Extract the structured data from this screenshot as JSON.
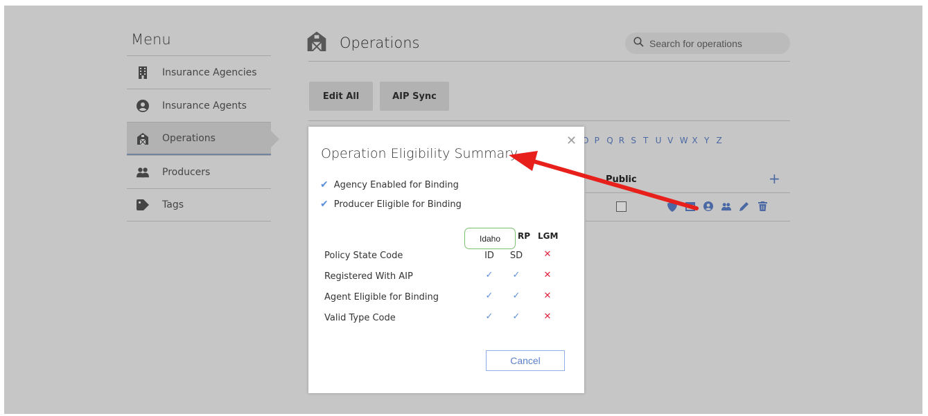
{
  "sidebar": {
    "title": "Menu",
    "items": [
      {
        "label": "Insurance Agencies",
        "icon": "building-icon"
      },
      {
        "label": "Insurance Agents",
        "icon": "user-circle-icon"
      },
      {
        "label": "Operations",
        "icon": "barn-icon",
        "active": true
      },
      {
        "label": "Producers",
        "icon": "users-icon"
      },
      {
        "label": "Tags",
        "icon": "tag-icon"
      }
    ]
  },
  "header": {
    "title": "Operations",
    "search_placeholder": "Search for operations"
  },
  "toolbar": {
    "edit_all_label": "Edit All",
    "aip_sync_label": "AIP Sync"
  },
  "alphabet_visible": [
    "O",
    "P",
    "Q",
    "R",
    "S",
    "T",
    "U",
    "V",
    "W",
    "X",
    "Y",
    "Z"
  ],
  "table": {
    "column_public": "Public",
    "add_label": "+",
    "row_actions": [
      "shield-icon",
      "calendar-icon",
      "user-circle-icon",
      "users-icon",
      "pencil-icon",
      "trash-icon"
    ]
  },
  "modal": {
    "title": "Operation Eligibility Summary",
    "close_label": "✕",
    "statuses": [
      {
        "label": "Agency Enabled for Binding",
        "ok": true
      },
      {
        "label": "Producer Eligible for Binding",
        "ok": true
      }
    ],
    "columns": [
      "",
      "RP",
      "LGM"
    ],
    "tooltip": "Idaho",
    "rows": [
      {
        "label": "Policy State Code",
        "cells": [
          "ID",
          "SD",
          "✕"
        ]
      },
      {
        "label": "Registered With AIP",
        "cells": [
          "✓",
          "✓",
          "✕"
        ]
      },
      {
        "label": "Agent Eligible for Binding",
        "cells": [
          "✓",
          "✓",
          "✕"
        ]
      },
      {
        "label": "Valid Type Code",
        "cells": [
          "✓",
          "✓",
          "✕"
        ]
      }
    ],
    "cancel_label": "Cancel"
  },
  "colors": {
    "accent_blue": "#5b7fc7",
    "check_blue": "#5b8fd9",
    "error_red": "#e0213d",
    "annotation_red": "#e8201c",
    "tooltip_green": "#7ac06f"
  }
}
